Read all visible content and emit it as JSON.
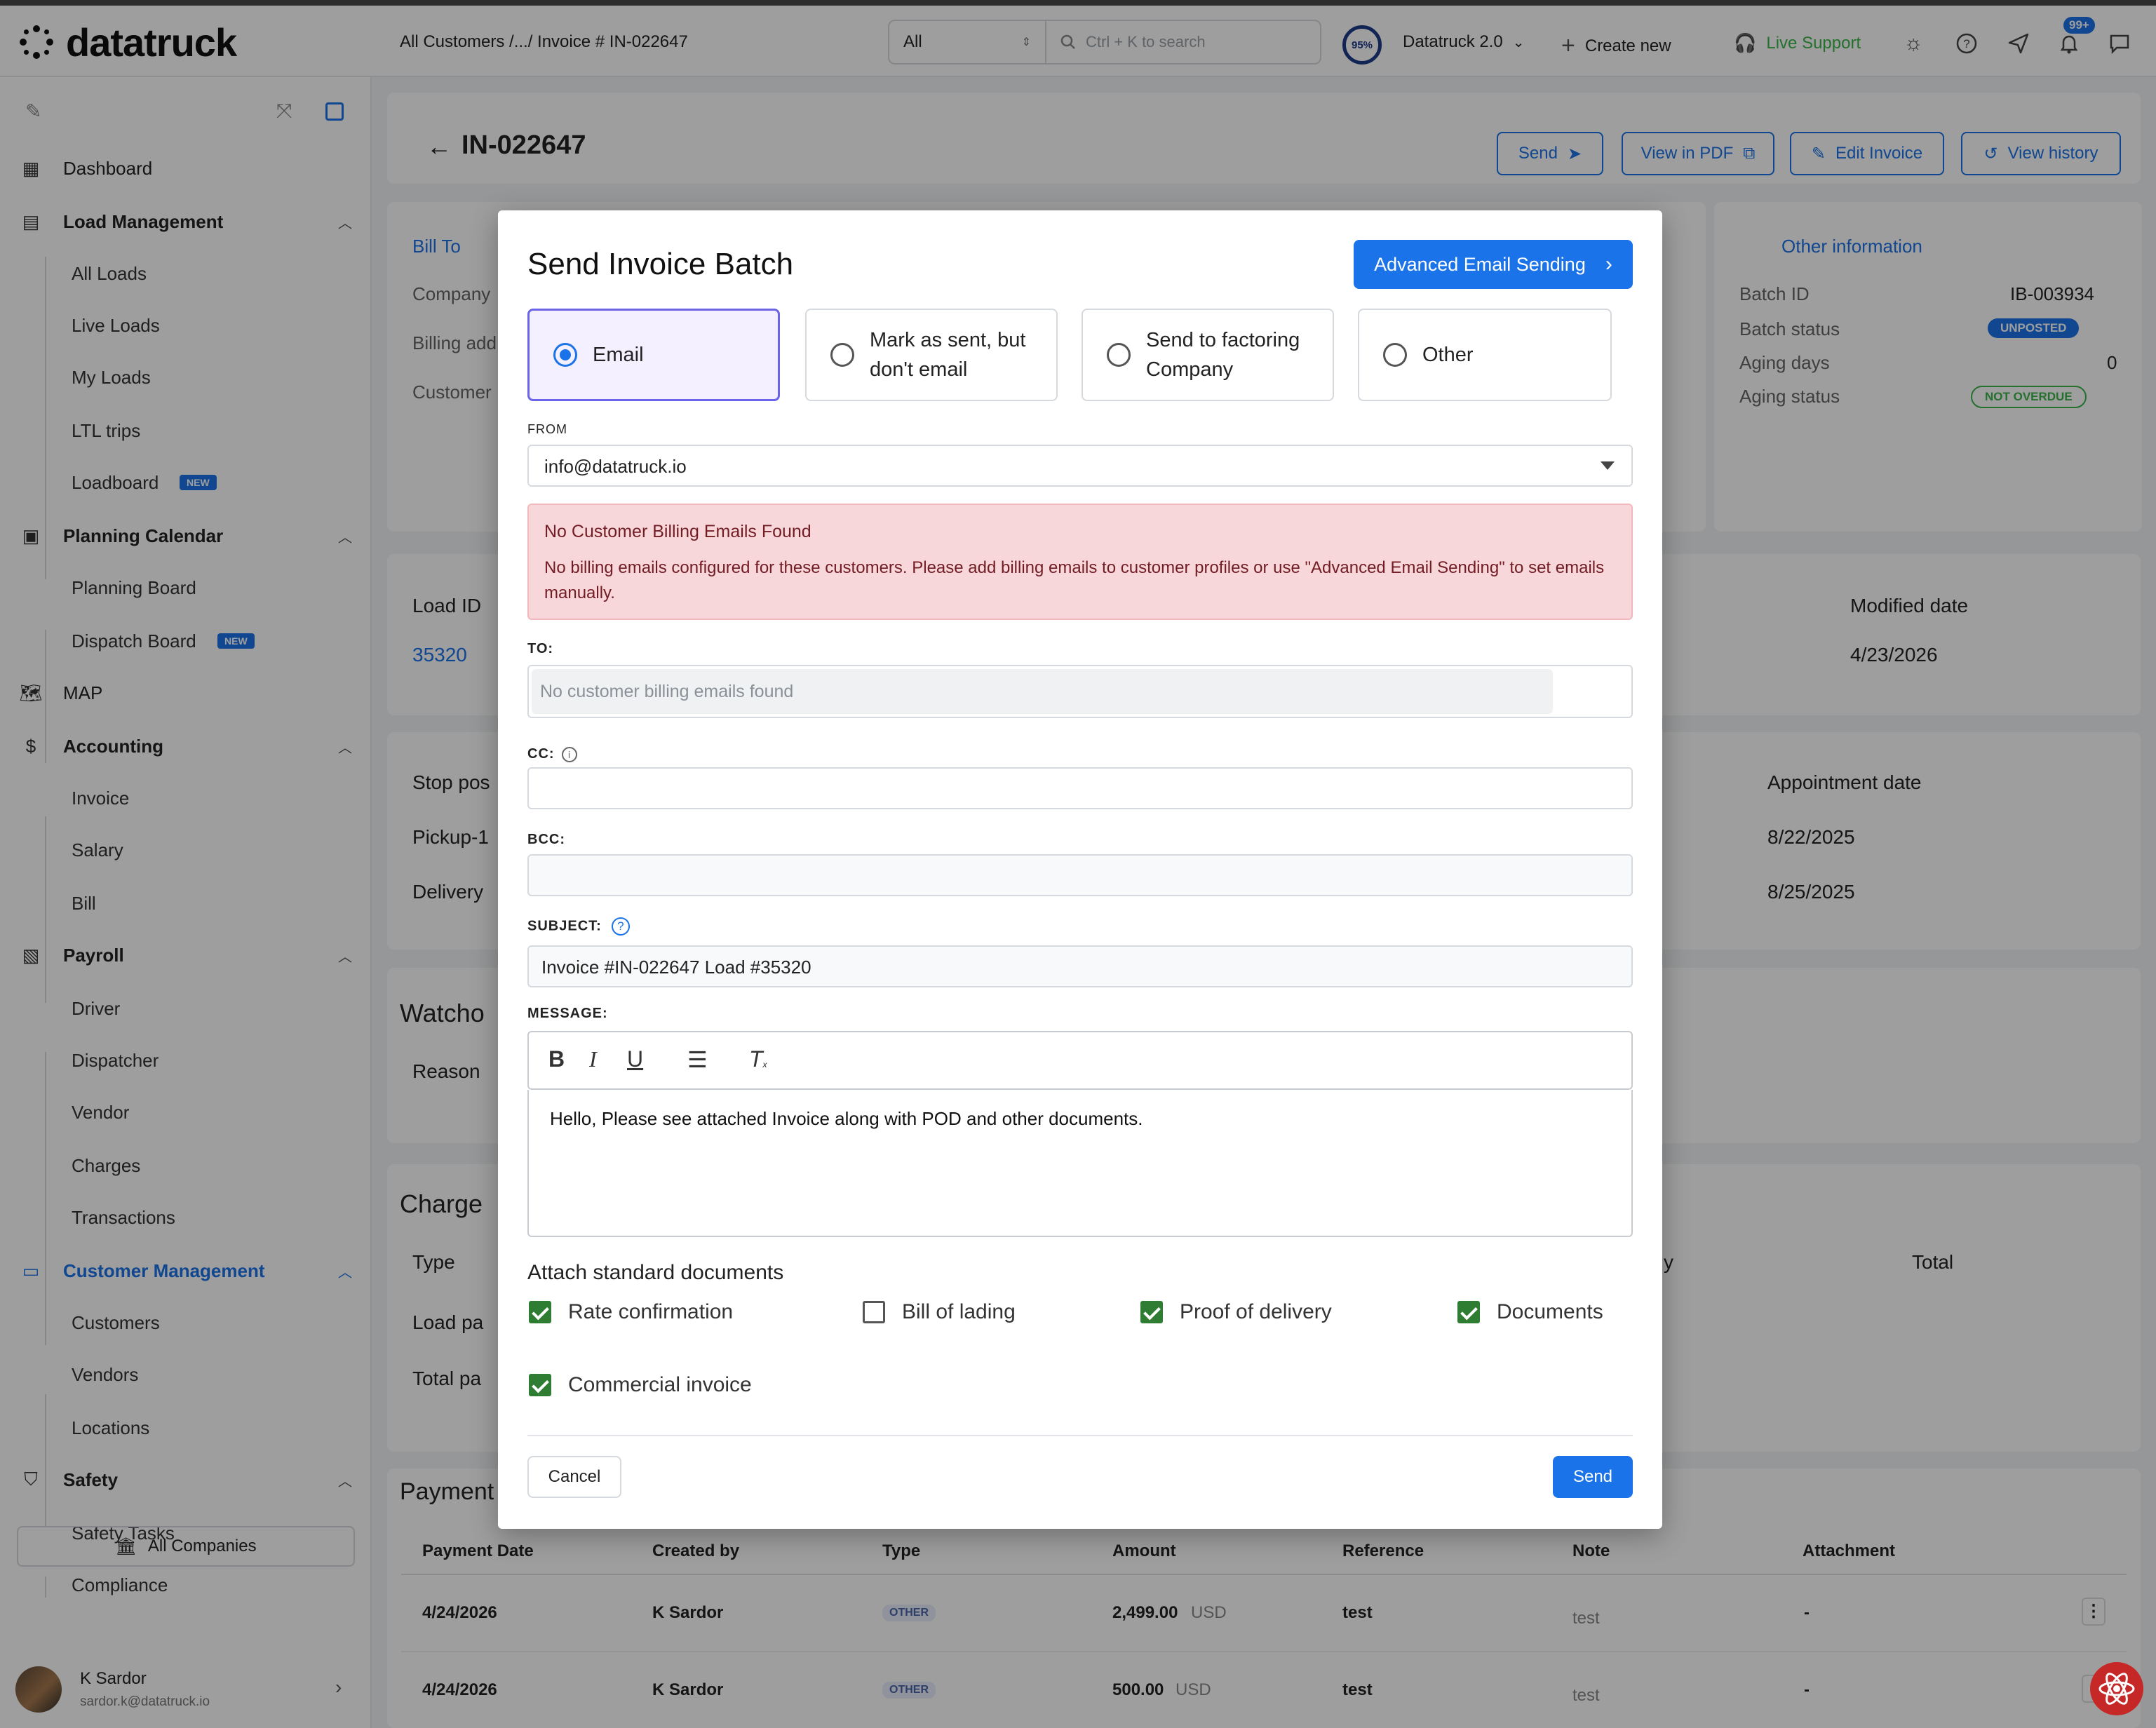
{
  "app": {
    "logo_text": "datatruck"
  },
  "header": {
    "breadcrumb": "All Customers /.../ Invoice # IN-022647",
    "search_scope": "All",
    "search_placeholder": "Ctrl + K to search",
    "progress_badge": "95%",
    "workspace": "Datatruck 2.0",
    "create_new": "Create new",
    "live_support": "Live Support",
    "notification_count": "99+"
  },
  "sidebar": {
    "items": [
      {
        "label": "Dashboard",
        "icon": "dashboard-icon"
      },
      {
        "label": "Load Management",
        "icon": "document-icon"
      },
      {
        "label": "All Loads"
      },
      {
        "label": "Live Loads"
      },
      {
        "label": "My Loads"
      },
      {
        "label": "LTL trips"
      },
      {
        "label": "Loadboard",
        "badge": "NEW"
      },
      {
        "label": "Planning Calendar",
        "icon": "calendar-icon"
      },
      {
        "label": "Planning Board"
      },
      {
        "label": "Dispatch Board",
        "badge": "NEW"
      },
      {
        "label": "MAP",
        "icon": "map-icon"
      },
      {
        "label": "Accounting",
        "icon": "dollar-icon"
      },
      {
        "label": "Invoice"
      },
      {
        "label": "Salary"
      },
      {
        "label": "Bill"
      },
      {
        "label": "Payroll",
        "icon": "payroll-icon"
      },
      {
        "label": "Driver"
      },
      {
        "label": "Dispatcher"
      },
      {
        "label": "Vendor"
      },
      {
        "label": "Charges"
      },
      {
        "label": "Transactions"
      },
      {
        "label": "Customer Management",
        "icon": "monitor-icon"
      },
      {
        "label": "Customers"
      },
      {
        "label": "Vendors"
      },
      {
        "label": "Locations"
      },
      {
        "label": "Safety",
        "icon": "shield-icon"
      },
      {
        "label": "Safety Tasks"
      },
      {
        "label": "Compliance"
      }
    ],
    "companies": "All Companies",
    "user_name": "K Sardor",
    "user_email": "sardor.k@datatruck.io"
  },
  "page": {
    "title": "IN-022647",
    "actions": {
      "send": "Send",
      "view_pdf": "View in PDF",
      "edit": "Edit Invoice",
      "history": "View history"
    },
    "bill_to": {
      "title": "Bill To",
      "company": "Company",
      "billing_address": "Billing add",
      "customer": "Customer"
    },
    "other_info": {
      "title": "Other information",
      "batch_id_label": "Batch ID",
      "batch_id": "IB-003934",
      "batch_status_label": "Batch status",
      "batch_status": "UNPOSTED",
      "aging_days_label": "Aging days",
      "aging_days": "0",
      "aging_status_label": "Aging status",
      "aging_status": "NOT OVERDUE"
    },
    "loads": {
      "col_load_id": "Load ID",
      "col_modified": "Modified date",
      "load_id": "35320",
      "modified": "4/23/2026"
    },
    "stops": {
      "col_stop": "Stop pos",
      "col_appt": "Appointment date",
      "rows": [
        {
          "stop": "Pickup-1",
          "date": "8/22/2025"
        },
        {
          "stop": "Delivery",
          "date": "8/25/2025"
        }
      ]
    },
    "watch": {
      "title": "Watcho",
      "reason": "Reason"
    },
    "charges": {
      "title": "Charge",
      "col_type": "Type",
      "col_y": "y",
      "col_total": "Total",
      "row1": "Load pa",
      "row2": "Total pa"
    },
    "payments": {
      "title": "Payment",
      "columns": [
        "Payment Date",
        "Created by",
        "Type",
        "Amount",
        "Reference",
        "Note",
        "Attachment"
      ],
      "rows": [
        {
          "date": "4/24/2026",
          "by": "K Sardor",
          "type": "OTHER",
          "amount": "2,499.00",
          "currency": "USD",
          "ref": "test",
          "note": "test",
          "att": "-"
        },
        {
          "date": "4/24/2026",
          "by": "K Sardor",
          "type": "OTHER",
          "amount": "500.00",
          "currency": "USD",
          "ref": "test",
          "note": "test",
          "att": "-"
        }
      ]
    }
  },
  "modal": {
    "title": "Send Invoice Batch",
    "advanced_button": "Advanced Email Sending",
    "options": [
      {
        "label": "Email",
        "selected": true
      },
      {
        "label": "Mark as sent, but don't email",
        "selected": false
      },
      {
        "label": "Send to factoring Company",
        "selected": false
      },
      {
        "label": "Other",
        "selected": false
      }
    ],
    "from_label": "FROM",
    "from_value": "info@datatruck.io",
    "alert_title": "No Customer Billing Emails Found",
    "alert_body": "No billing emails configured for these customers. Please add billing emails to customer profiles or use \"Advanced Email Sending\" to set emails manually.",
    "to_label": "TO:",
    "to_placeholder": "No customer billing emails found",
    "cc_label": "CC:",
    "bcc_label": "BCC:",
    "subject_label": "SUBJECT:",
    "subject_value": "Invoice #IN-022647 Load #35320",
    "message_label": "MESSAGE:",
    "message_value": "Hello, Please see attached Invoice along with POD and other documents.",
    "attach_title": "Attach standard documents",
    "documents": [
      {
        "label": "Rate confirmation",
        "checked": true
      },
      {
        "label": "Bill of lading",
        "checked": false
      },
      {
        "label": "Proof of delivery",
        "checked": true
      },
      {
        "label": "Documents",
        "checked": true
      },
      {
        "label": "Commercial invoice",
        "checked": true
      }
    ],
    "cancel": "Cancel",
    "send": "Send"
  },
  "colors": {
    "accent": "#1a73e8",
    "alert_bg": "#f8d7da",
    "alert_text": "#721c24",
    "check": "#2e7d32",
    "selected_option_border": "#6b63e8"
  }
}
